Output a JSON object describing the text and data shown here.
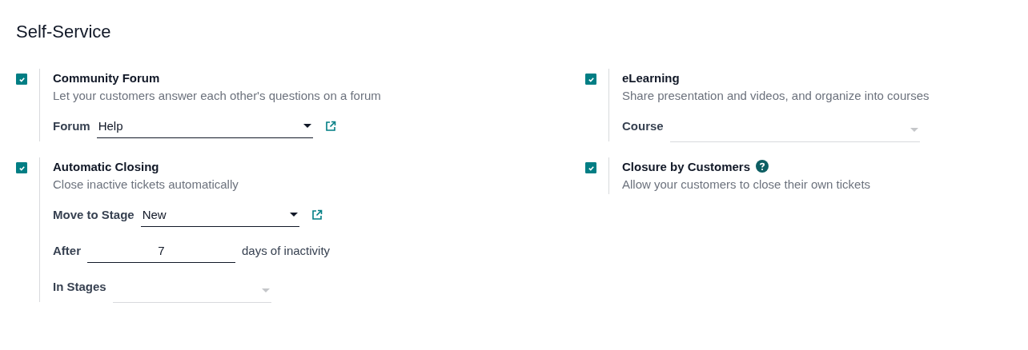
{
  "section_title": "Self-Service",
  "settings": [
    {
      "title": "Community Forum",
      "description": "Let your customers answer each other's questions on a forum",
      "checked": true,
      "help": false,
      "fields": [
        {
          "kind": "select",
          "label": "Forum",
          "value": "Help",
          "link": true
        }
      ]
    },
    {
      "title": "eLearning",
      "description": "Share presentation and videos, and organize into courses",
      "checked": true,
      "help": false,
      "fields": [
        {
          "kind": "select",
          "label": "Course",
          "link": false
        }
      ]
    },
    {
      "title": "Automatic Closing",
      "description": "Close inactive tickets automatically",
      "checked": true,
      "help": false,
      "fields": [
        {
          "kind": "select",
          "label": "Move to Stage",
          "value": "New",
          "link": true
        },
        {
          "kind": "number",
          "label": "After",
          "value": "7",
          "suffix": "days of inactivity"
        },
        {
          "kind": "select",
          "label": "In Stages",
          "link": false
        }
      ]
    },
    {
      "title": "Closure by Customers",
      "description": "Allow your customers to close their own tickets",
      "checked": true,
      "help": true
    }
  ]
}
